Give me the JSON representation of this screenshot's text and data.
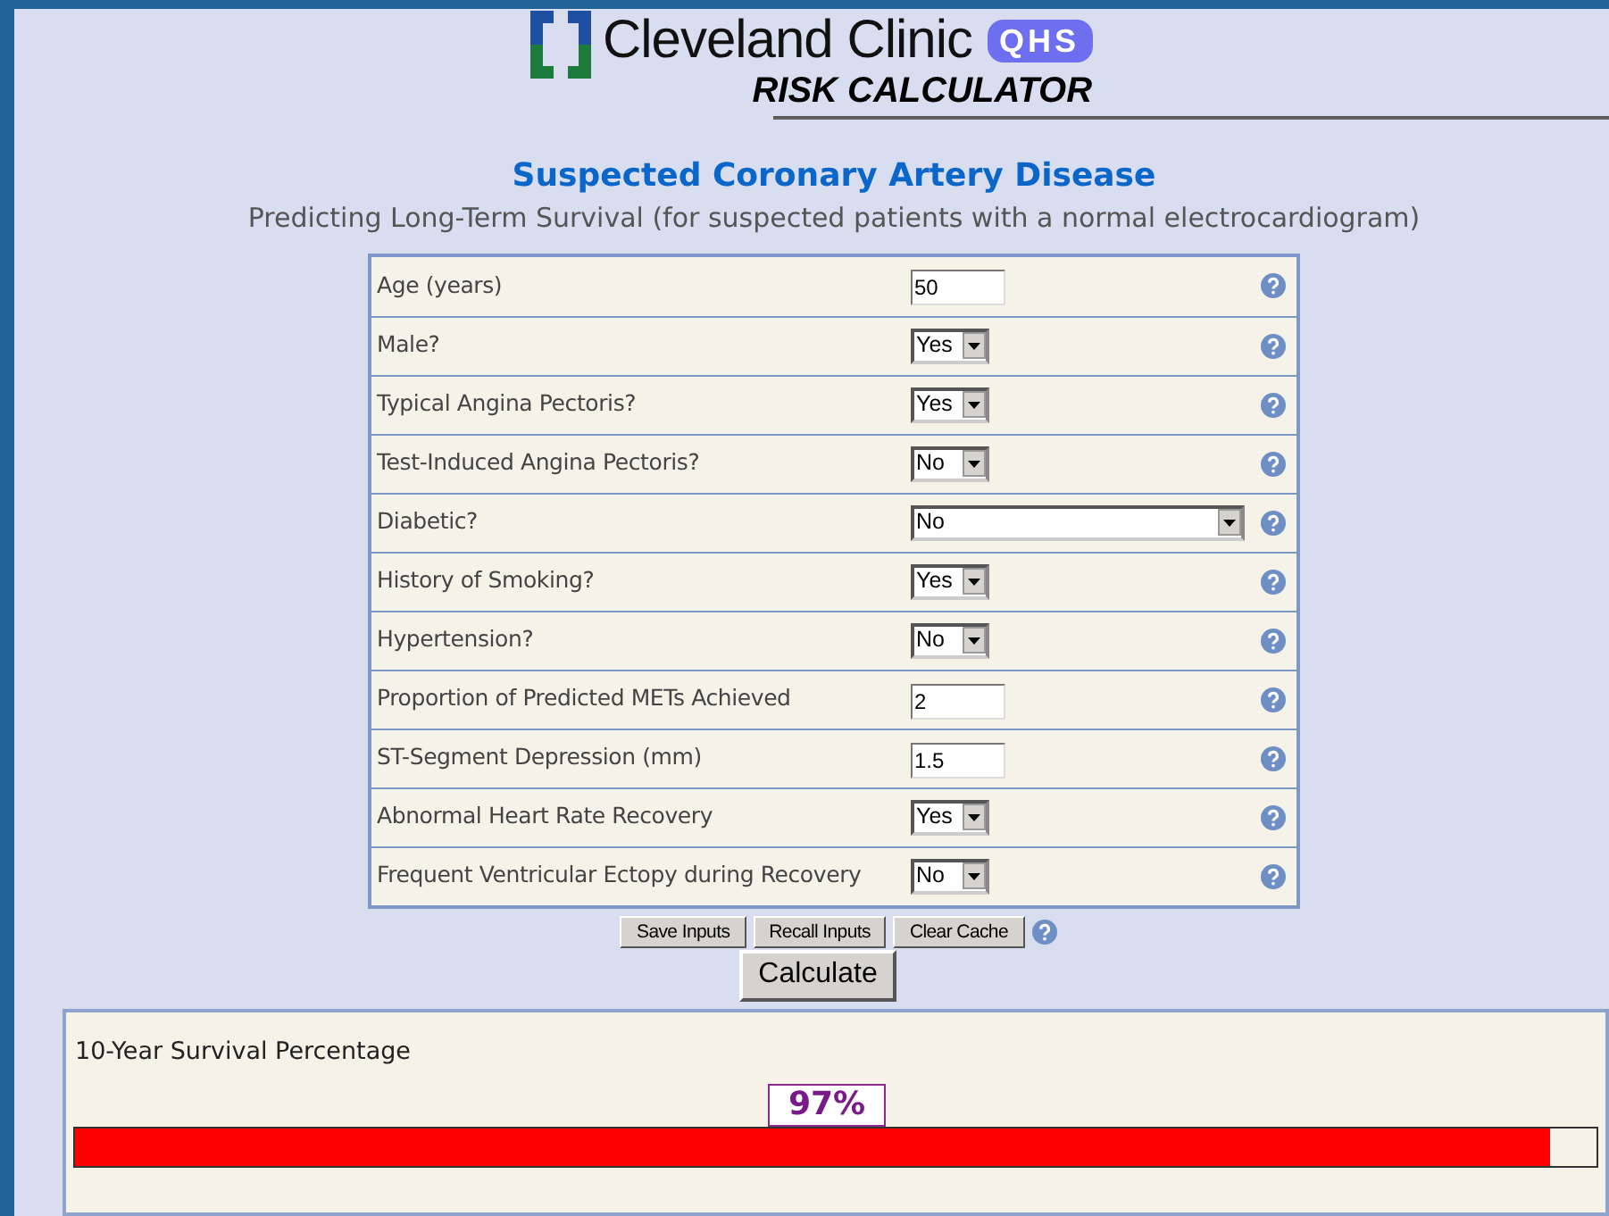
{
  "header": {
    "brand": "Cleveland Clinic",
    "badge": "QHS",
    "subtitle": "RISK CALCULATOR"
  },
  "title": "Suspected Coronary Artery Disease",
  "description": "Predicting Long-Term Survival (for suspected patients with a normal electrocardiogram)",
  "fields": [
    {
      "label": "Age (years)",
      "kind": "text",
      "value": "50"
    },
    {
      "label": "Male?",
      "kind": "select",
      "value": "Yes"
    },
    {
      "label": "Typical Angina Pectoris?",
      "kind": "select",
      "value": "Yes"
    },
    {
      "label": "Test-Induced Angina Pectoris?",
      "kind": "select",
      "value": "No"
    },
    {
      "label": "Diabetic?",
      "kind": "wide_select",
      "value": "No"
    },
    {
      "label": "History of Smoking?",
      "kind": "select",
      "value": "Yes"
    },
    {
      "label": "Hypertension?",
      "kind": "select",
      "value": "No"
    },
    {
      "label": "Proportion of Predicted METs Achieved",
      "kind": "text",
      "value": "2"
    },
    {
      "label": "ST-Segment Depression (mm)",
      "kind": "text",
      "value": "1.5"
    },
    {
      "label": "Abnormal Heart Rate Recovery",
      "kind": "select",
      "value": "Yes"
    },
    {
      "label": "Frequent Ventricular Ectopy during Recovery",
      "kind": "select",
      "value": "No"
    }
  ],
  "buttons": [
    "Save Inputs",
    "Recall Inputs",
    "Clear Cache"
  ],
  "calculate": "Calculate",
  "result": {
    "label": "10-Year Survival Percentage",
    "value": "97%",
    "level": 0.97
  }
}
